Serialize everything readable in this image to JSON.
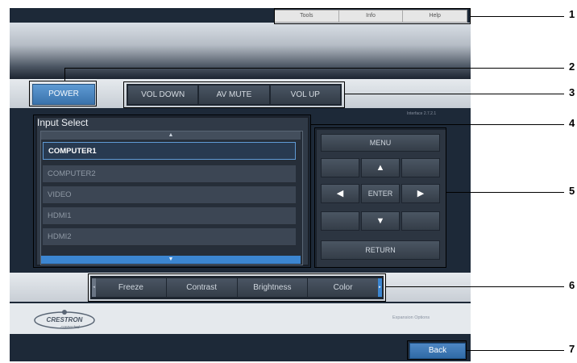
{
  "top_menu": {
    "tools": "Tools",
    "info": "Info",
    "help": "Help"
  },
  "power_label": "POWER",
  "volume": {
    "vol_down": "VOL DOWN",
    "av_mute": "AV MUTE",
    "vol_up": "VOL UP"
  },
  "interface_version": "Interface 2.7.2.1",
  "input_select": {
    "title": "Input Select",
    "scroll_up": "▲",
    "scroll_down": "▼",
    "items": [
      "COMPUTER1",
      "COMPUTER2",
      "VIDEO",
      "HDMI1",
      "HDMI2"
    ],
    "selected": "COMPUTER1"
  },
  "nav": {
    "menu": "MENU",
    "up": "▲",
    "left": "◀",
    "enter": "ENTER",
    "right": "▶",
    "down": "▼",
    "return": "RETURN"
  },
  "functions": {
    "freeze": "Freeze",
    "contrast": "Contrast",
    "brightness": "Brightness",
    "color": "Color",
    "scroll_left": "◂",
    "scroll_right": "▸"
  },
  "logo": {
    "brand": "CRESTRON",
    "tagline": "connected"
  },
  "expansion_options": "Expansion Options",
  "back_label": "Back",
  "callouts": [
    "1",
    "2",
    "3",
    "4",
    "5",
    "6",
    "7"
  ]
}
